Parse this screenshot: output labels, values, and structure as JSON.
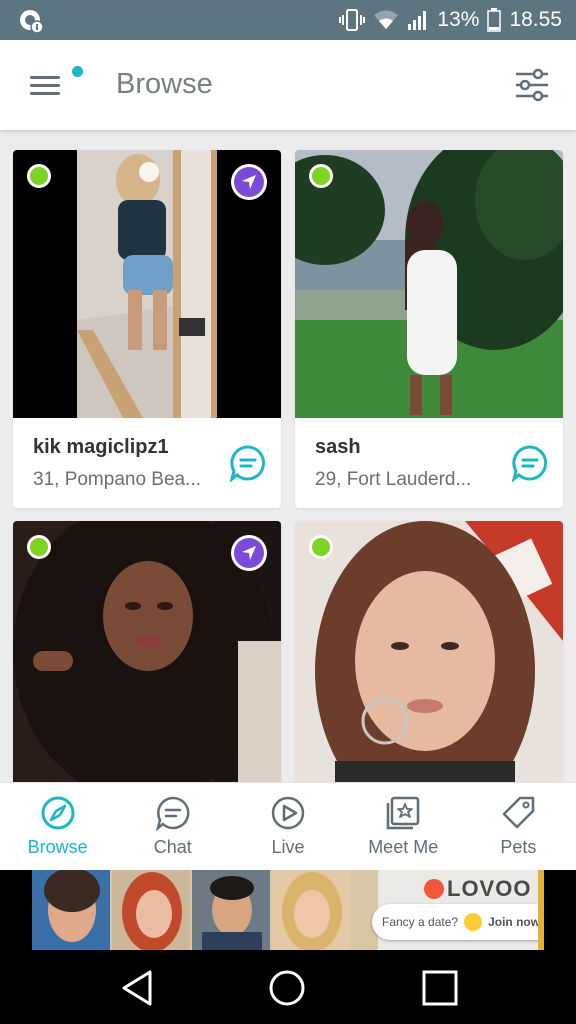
{
  "status_bar": {
    "battery": "13%",
    "time": "18.55",
    "icons": [
      "app-notification-icon",
      "vibrate-icon",
      "wifi-icon",
      "signal-icon",
      "battery-icon"
    ]
  },
  "app_bar": {
    "title": "Browse",
    "menu_icon": "hamburger-menu-icon",
    "filter_icon": "filter-sliders-icon",
    "notification_dot_color": "#1ab7c4"
  },
  "profiles": [
    {
      "name": "kik magiclipz1",
      "meta": "31, Pompano Bea...",
      "online": true,
      "nearby": true
    },
    {
      "name": "sash",
      "meta": "29, Fort Lauderd...",
      "online": true,
      "nearby": false
    },
    {
      "name": "",
      "meta": "",
      "online": true,
      "nearby": true
    },
    {
      "name": "",
      "meta": "",
      "online": true,
      "nearby": false
    }
  ],
  "bottom_nav": [
    {
      "label": "Browse",
      "icon": "compass-icon",
      "active": true
    },
    {
      "label": "Chat",
      "icon": "chat-bubble-icon",
      "active": false
    },
    {
      "label": "Live",
      "icon": "play-circle-icon",
      "active": false
    },
    {
      "label": "Meet Me",
      "icon": "star-cards-icon",
      "active": false
    },
    {
      "label": "Pets",
      "icon": "tag-icon",
      "active": false
    }
  ],
  "ad": {
    "brand": "LOVOO",
    "tagline": "Fancy a date?",
    "cta": "Join now!"
  },
  "system_nav": [
    "back-icon",
    "home-icon",
    "recents-icon"
  ],
  "colors": {
    "accent": "#1ab7c4",
    "online": "#7cd322",
    "nearby": "#7a4bd6",
    "status_bar": "#5d7481"
  }
}
